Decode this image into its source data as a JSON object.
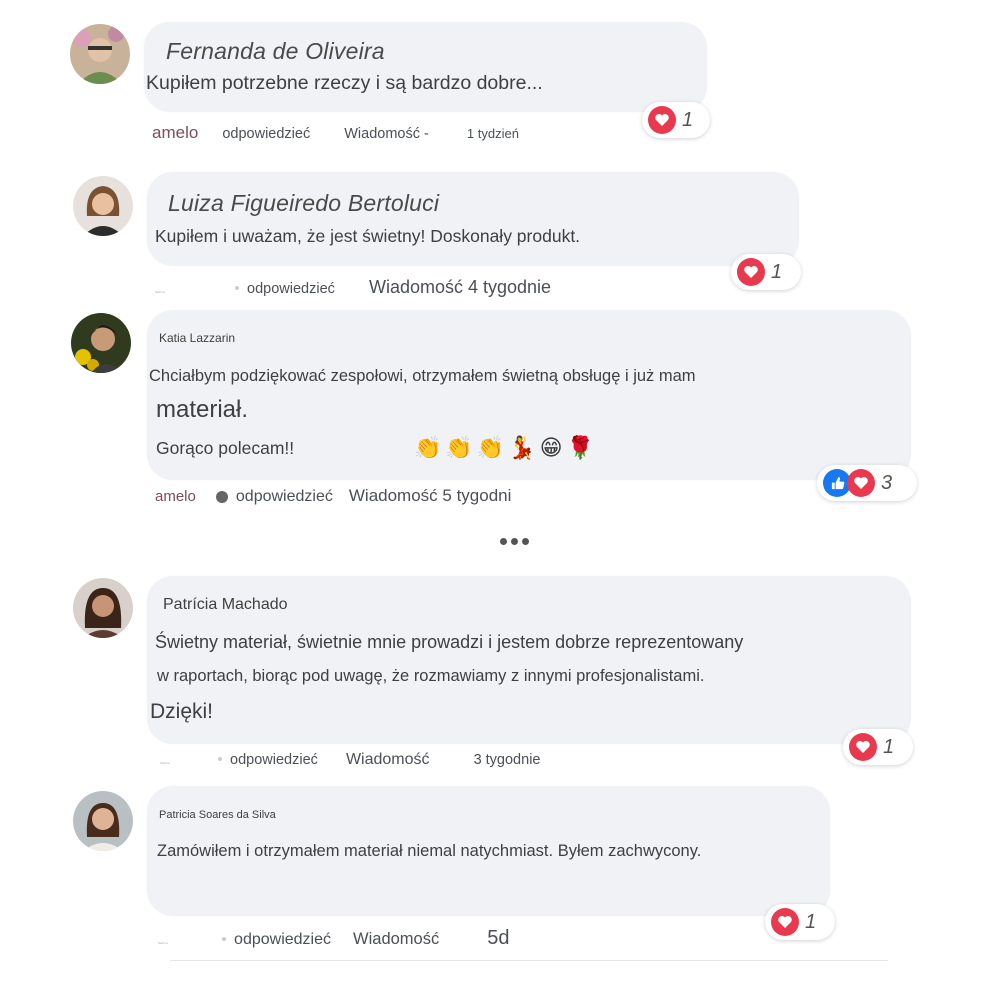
{
  "comments": [
    {
      "name": "Fernanda de Oliveira",
      "lines": [
        "Kupiłem potrzebne rzeczy i są bardzo dobre..."
      ],
      "meta": {
        "like": "amelo",
        "reply": "odpowiedzieć",
        "message": "Wiadomość -",
        "time": "1 tydzień"
      },
      "reactions": "1"
    },
    {
      "name": "Luiza Figueiredo Bertoluci",
      "lines": [
        "Kupiłem i uważam, że jest świetny! Doskonały produkt."
      ],
      "meta": {
        "like": "",
        "reply": "odpowiedzieć",
        "message": "Wiadomość 4 tygodnie",
        "time": ""
      },
      "reactions": "1"
    },
    {
      "name": "Katia Lazzarin",
      "lines": [
        "Chciałbym podziękować zespołowi, otrzymałem świetną obsługę i już mam",
        "materiał.",
        "Gorąco polecam!!"
      ],
      "meta": {
        "like": "amelo",
        "reply": "odpowiedzieć",
        "message": "Wiadomość 5 tygodni",
        "time": ""
      },
      "reactions": "3"
    },
    {
      "name": "Patrícia Machado",
      "lines": [
        "Świetny materiał, świetnie mnie prowadzi i jestem dobrze reprezentowany",
        "w raportach, biorąc pod uwagę, że rozmawiamy z innymi profesjonalistami.",
        "Dzięki!"
      ],
      "meta": {
        "like": "",
        "reply": "odpowiedzieć",
        "message": "Wiadomość",
        "time": "3 tygodnie"
      },
      "reactions": "1"
    },
    {
      "name": "Patricia Soares da Silva",
      "lines": [
        "Zamówiłem i otrzymałem materiał niemal natychmiast. Byłem zachwycony."
      ],
      "meta": {
        "like": "",
        "reply": "odpowiedzieć",
        "message": "Wiadomość",
        "time": "5d"
      },
      "reactions": "1"
    }
  ],
  "colors": {
    "bubble": "#f0f2f5",
    "heart": "#e8394e",
    "like_blue": "#1877f2",
    "like_text": "#7a4e5a"
  },
  "icons": {
    "heart": "heart-icon",
    "like": "thumbs-up-icon",
    "more": "more-dots-icon"
  }
}
